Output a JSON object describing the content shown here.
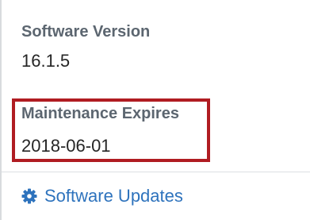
{
  "fields": {
    "software_version": {
      "label": "Software Version",
      "value": "16.1.5"
    },
    "maintenance_expires": {
      "label": "Maintenance Expires",
      "value": "2018-06-01"
    }
  },
  "links": {
    "software_updates": {
      "label": "Software Updates",
      "icon": "gear-icon"
    }
  },
  "colors": {
    "label": "#5c6670",
    "value": "#262626",
    "highlight": "#b01c22",
    "link": "#2e73bd"
  }
}
